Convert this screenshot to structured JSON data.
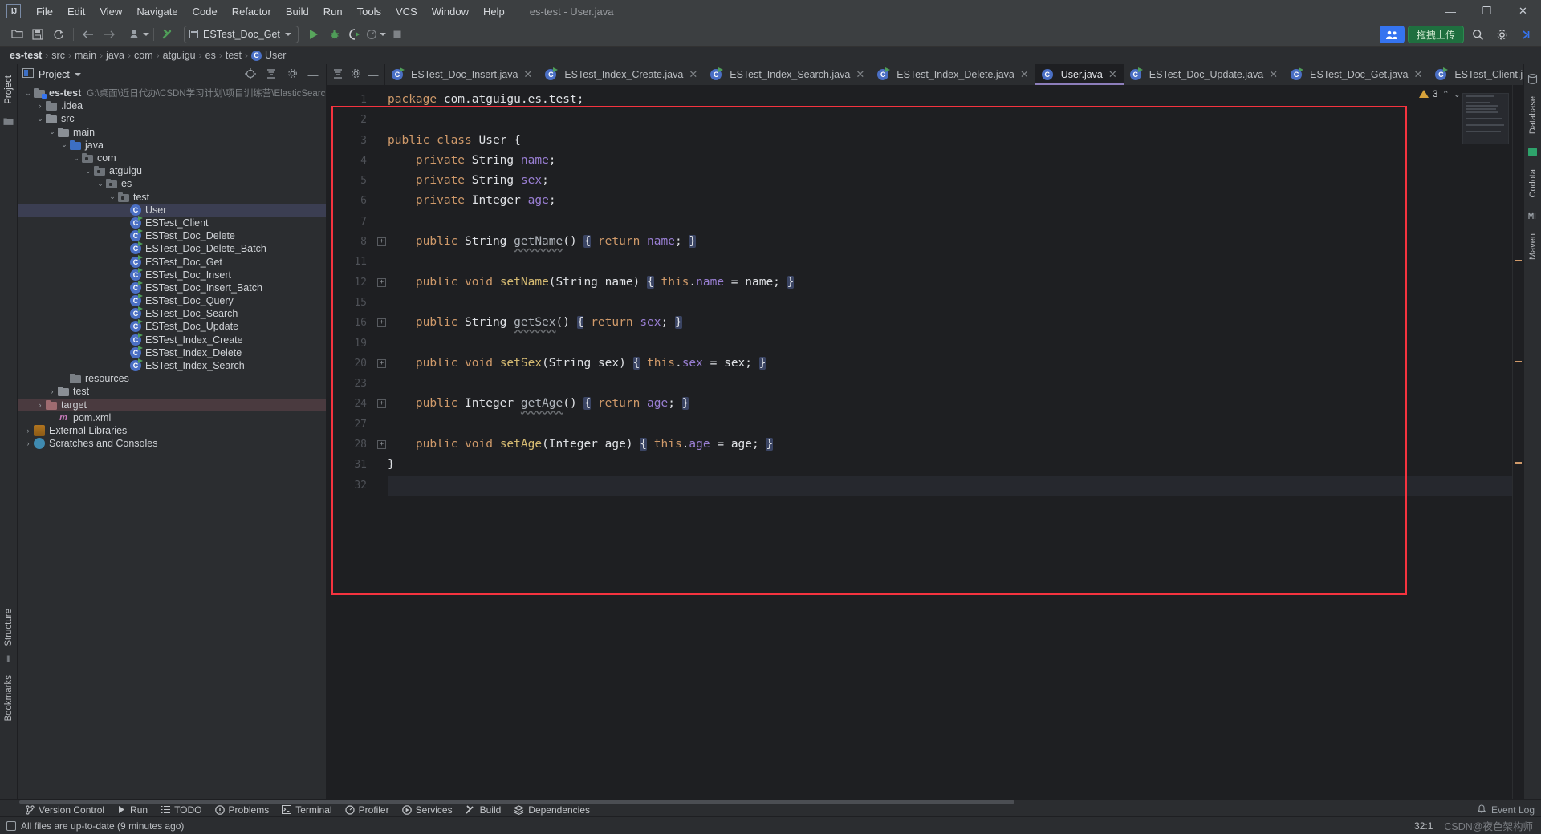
{
  "window": {
    "title": "es-test - User.java",
    "logo": "IJ",
    "minimize": "—",
    "maximize": "❐",
    "close": "✕"
  },
  "menu": {
    "items": [
      "File",
      "Edit",
      "View",
      "Navigate",
      "Code",
      "Refactor",
      "Build",
      "Run",
      "Tools",
      "VCS",
      "Window",
      "Help"
    ]
  },
  "toolbar": {
    "icons": [
      "open-folder-icon",
      "save-icon",
      "sync-icon",
      "back-arrow-icon",
      "forward-arrow-icon",
      "profile-icon",
      "build-hammer-icon"
    ],
    "run_config": "ESTest_Doc_Get",
    "run_label": "run-icon",
    "debug_label": "debug-icon",
    "coverage_label": "run-coverage-icon",
    "profile_label": "profiler-icon",
    "stop_label": "stop-icon",
    "right_badge_blue": "👥",
    "right_badge_green": "拖拽上传",
    "search_icon": "search-icon",
    "settings_icon": "gear-icon",
    "expand_icon": "chevron-right-icon"
  },
  "breadcrumb": {
    "items": [
      "es-test",
      "src",
      "main",
      "java",
      "com",
      "atguigu",
      "es"
    ],
    "last_folder": "test",
    "class": "User",
    "separator": "›"
  },
  "left_strip": {
    "project_label": "Project",
    "structure_label": "Structure",
    "bookmarks_label": "Bookmarks",
    "folder_icon": "folder-icon"
  },
  "right_strip": {
    "database_label": "Database",
    "codota_label": "Codota",
    "maven_label": "Maven"
  },
  "project_panel": {
    "title": "Project",
    "dropdown_icon": "chevron-down-icon",
    "locate_icon": "target-icon",
    "collapse_icon": "collapse-all-icon",
    "settings_icon": "gear-icon",
    "hide_icon": "minimize-icon",
    "tree": [
      {
        "label": "es-test",
        "path": "G:\\桌面\\近日代办\\CSDN学习计划\\项目训练营\\ElasticSearch\\代码\\es-te",
        "indent": 0,
        "arrow": "⌄",
        "icon": "module-folder",
        "bold": true
      },
      {
        "label": ".idea",
        "indent": 1,
        "arrow": "›",
        "icon": "folder"
      },
      {
        "label": "src",
        "indent": 1,
        "arrow": "⌄",
        "icon": "folder-src"
      },
      {
        "label": "main",
        "indent": 2,
        "arrow": "⌄",
        "icon": "folder-src"
      },
      {
        "label": "java",
        "indent": 3,
        "arrow": "⌄",
        "icon": "folder-blue"
      },
      {
        "label": "com",
        "indent": 4,
        "arrow": "⌄",
        "icon": "folder-pkg"
      },
      {
        "label": "atguigu",
        "indent": 5,
        "arrow": "⌄",
        "icon": "folder-pkg"
      },
      {
        "label": "es",
        "indent": 6,
        "arrow": "⌄",
        "icon": "folder-pkg"
      },
      {
        "label": "test",
        "indent": 7,
        "arrow": "⌄",
        "icon": "folder-pkg"
      },
      {
        "label": "User",
        "indent": 8,
        "arrow": "",
        "icon": "java-class",
        "selected": true
      },
      {
        "label": "ESTest_Client",
        "indent": 8,
        "arrow": "",
        "icon": "java-class-runnable"
      },
      {
        "label": "ESTest_Doc_Delete",
        "indent": 8,
        "arrow": "",
        "icon": "java-class-runnable"
      },
      {
        "label": "ESTest_Doc_Delete_Batch",
        "indent": 8,
        "arrow": "",
        "icon": "java-class-runnable"
      },
      {
        "label": "ESTest_Doc_Get",
        "indent": 8,
        "arrow": "",
        "icon": "java-class-runnable"
      },
      {
        "label": "ESTest_Doc_Insert",
        "indent": 8,
        "arrow": "",
        "icon": "java-class-runnable"
      },
      {
        "label": "ESTest_Doc_Insert_Batch",
        "indent": 8,
        "arrow": "",
        "icon": "java-class-runnable"
      },
      {
        "label": "ESTest_Doc_Query",
        "indent": 8,
        "arrow": "",
        "icon": "java-class-runnable"
      },
      {
        "label": "ESTest_Doc_Search",
        "indent": 8,
        "arrow": "",
        "icon": "java-class-runnable"
      },
      {
        "label": "ESTest_Doc_Update",
        "indent": 8,
        "arrow": "",
        "icon": "java-class-runnable"
      },
      {
        "label": "ESTest_Index_Create",
        "indent": 8,
        "arrow": "",
        "icon": "java-class-runnable"
      },
      {
        "label": "ESTest_Index_Delete",
        "indent": 8,
        "arrow": "",
        "icon": "java-class-runnable"
      },
      {
        "label": "ESTest_Index_Search",
        "indent": 8,
        "arrow": "",
        "icon": "java-class-runnable"
      },
      {
        "label": "resources",
        "indent": 3,
        "arrow": "",
        "icon": "folder"
      },
      {
        "label": "test",
        "indent": 2,
        "arrow": "›",
        "icon": "folder-src"
      },
      {
        "label": "target",
        "indent": 1,
        "arrow": "›",
        "icon": "folder-red",
        "highlight": true
      },
      {
        "label": "pom.xml",
        "indent": 2,
        "arrow": "",
        "icon": "maven-xml"
      },
      {
        "label": "External Libraries",
        "indent": 0,
        "arrow": "›",
        "icon": "library"
      },
      {
        "label": "Scratches and Consoles",
        "indent": 0,
        "arrow": "›",
        "icon": "scratch"
      }
    ]
  },
  "editor_tabs": {
    "pre_icons": [
      "collapse-all-icon",
      "gear-icon",
      "minimize-icon"
    ],
    "tabs": [
      {
        "label": "ESTest_Doc_Insert.java",
        "icon": "java-class-runnable",
        "active": false
      },
      {
        "label": "ESTest_Index_Create.java",
        "icon": "java-class-runnable",
        "active": false
      },
      {
        "label": "ESTest_Index_Search.java",
        "icon": "java-class-runnable",
        "active": false
      },
      {
        "label": "ESTest_Index_Delete.java",
        "icon": "java-class-runnable",
        "active": false
      },
      {
        "label": "User.java",
        "icon": "java-class",
        "active": true
      },
      {
        "label": "ESTest_Doc_Update.java",
        "icon": "java-class-runnable",
        "active": false
      },
      {
        "label": "ESTest_Doc_Get.java",
        "icon": "java-class-runnable",
        "active": false
      },
      {
        "label": "ESTest_Client.ja",
        "icon": "java-class-runnable",
        "active": false
      }
    ],
    "overflow_icon": "chevron-down-icon",
    "more_icon": "more-vertical-icon",
    "close_icon": "✕"
  },
  "inspection": {
    "warning_count": "3",
    "warning_icon": "warning-triangle-icon",
    "up_icon": "chevron-up-icon",
    "down_icon": "chevron-down-icon"
  },
  "code": {
    "file": "User.java",
    "lines": [
      {
        "num": "1",
        "fold": false,
        "tokens": [
          {
            "t": "k",
            "v": "package "
          },
          {
            "t": "t",
            "v": "com.atguigu.es.test;"
          }
        ]
      },
      {
        "num": "2",
        "fold": false,
        "tokens": []
      },
      {
        "num": "3",
        "fold": false,
        "tokens": [
          {
            "t": "k",
            "v": "public class "
          },
          {
            "t": "t",
            "v": "User {"
          }
        ]
      },
      {
        "num": "4",
        "fold": false,
        "tokens": [
          {
            "t": "t",
            "v": "    "
          },
          {
            "t": "k",
            "v": "private "
          },
          {
            "t": "t",
            "v": "String "
          },
          {
            "t": "f",
            "v": "name"
          },
          {
            "t": "t",
            "v": ";"
          }
        ]
      },
      {
        "num": "5",
        "fold": false,
        "tokens": [
          {
            "t": "t",
            "v": "    "
          },
          {
            "t": "k",
            "v": "private "
          },
          {
            "t": "t",
            "v": "String "
          },
          {
            "t": "f",
            "v": "sex"
          },
          {
            "t": "t",
            "v": ";"
          }
        ]
      },
      {
        "num": "6",
        "fold": false,
        "tokens": [
          {
            "t": "t",
            "v": "    "
          },
          {
            "t": "k",
            "v": "private "
          },
          {
            "t": "t",
            "v": "Integer "
          },
          {
            "t": "f",
            "v": "age"
          },
          {
            "t": "t",
            "v": ";"
          }
        ]
      },
      {
        "num": "7",
        "fold": false,
        "tokens": []
      },
      {
        "num": "8",
        "fold": true,
        "tokens": [
          {
            "t": "t",
            "v": "    "
          },
          {
            "t": "k",
            "v": "public "
          },
          {
            "t": "t",
            "v": "String "
          },
          {
            "t": "mu",
            "v": "getName"
          },
          {
            "t": "t",
            "v": "() "
          },
          {
            "t": "brace",
            "v": "{"
          },
          {
            "t": "t",
            "v": " "
          },
          {
            "t": "k",
            "v": "return "
          },
          {
            "t": "f",
            "v": "name"
          },
          {
            "t": "t",
            "v": "; "
          },
          {
            "t": "brace",
            "v": "}"
          }
        ]
      },
      {
        "num": "11",
        "fold": false,
        "tokens": []
      },
      {
        "num": "12",
        "fold": true,
        "tokens": [
          {
            "t": "t",
            "v": "    "
          },
          {
            "t": "k",
            "v": "public "
          },
          {
            "t": "k",
            "v": "void "
          },
          {
            "t": "m",
            "v": "setName"
          },
          {
            "t": "t",
            "v": "(String name) "
          },
          {
            "t": "brace",
            "v": "{"
          },
          {
            "t": "t",
            "v": " "
          },
          {
            "t": "k",
            "v": "this"
          },
          {
            "t": "t",
            "v": "."
          },
          {
            "t": "f",
            "v": "name"
          },
          {
            "t": "t",
            "v": " = name; "
          },
          {
            "t": "brace",
            "v": "}"
          }
        ]
      },
      {
        "num": "15",
        "fold": false,
        "tokens": []
      },
      {
        "num": "16",
        "fold": true,
        "tokens": [
          {
            "t": "t",
            "v": "    "
          },
          {
            "t": "k",
            "v": "public "
          },
          {
            "t": "t",
            "v": "String "
          },
          {
            "t": "mu",
            "v": "getSex"
          },
          {
            "t": "t",
            "v": "() "
          },
          {
            "t": "brace",
            "v": "{"
          },
          {
            "t": "t",
            "v": " "
          },
          {
            "t": "k",
            "v": "return "
          },
          {
            "t": "f",
            "v": "sex"
          },
          {
            "t": "t",
            "v": "; "
          },
          {
            "t": "brace",
            "v": "}"
          }
        ]
      },
      {
        "num": "19",
        "fold": false,
        "tokens": []
      },
      {
        "num": "20",
        "fold": true,
        "tokens": [
          {
            "t": "t",
            "v": "    "
          },
          {
            "t": "k",
            "v": "public "
          },
          {
            "t": "k",
            "v": "void "
          },
          {
            "t": "m",
            "v": "setSex"
          },
          {
            "t": "t",
            "v": "(String sex) "
          },
          {
            "t": "brace",
            "v": "{"
          },
          {
            "t": "t",
            "v": " "
          },
          {
            "t": "k",
            "v": "this"
          },
          {
            "t": "t",
            "v": "."
          },
          {
            "t": "f",
            "v": "sex"
          },
          {
            "t": "t",
            "v": " = sex; "
          },
          {
            "t": "brace",
            "v": "}"
          }
        ]
      },
      {
        "num": "23",
        "fold": false,
        "tokens": []
      },
      {
        "num": "24",
        "fold": true,
        "tokens": [
          {
            "t": "t",
            "v": "    "
          },
          {
            "t": "k",
            "v": "public "
          },
          {
            "t": "t",
            "v": "Integer "
          },
          {
            "t": "mu",
            "v": "getAge"
          },
          {
            "t": "t",
            "v": "() "
          },
          {
            "t": "brace",
            "v": "{"
          },
          {
            "t": "t",
            "v": " "
          },
          {
            "t": "k",
            "v": "return "
          },
          {
            "t": "f",
            "v": "age"
          },
          {
            "t": "t",
            "v": "; "
          },
          {
            "t": "brace",
            "v": "}"
          }
        ]
      },
      {
        "num": "27",
        "fold": false,
        "tokens": []
      },
      {
        "num": "28",
        "fold": true,
        "tokens": [
          {
            "t": "t",
            "v": "    "
          },
          {
            "t": "k",
            "v": "public "
          },
          {
            "t": "k",
            "v": "void "
          },
          {
            "t": "m",
            "v": "setAge"
          },
          {
            "t": "t",
            "v": "(Integer age) "
          },
          {
            "t": "brace",
            "v": "{"
          },
          {
            "t": "t",
            "v": " "
          },
          {
            "t": "k",
            "v": "this"
          },
          {
            "t": "t",
            "v": "."
          },
          {
            "t": "f",
            "v": "age"
          },
          {
            "t": "t",
            "v": " = age; "
          },
          {
            "t": "brace",
            "v": "}"
          }
        ]
      },
      {
        "num": "31",
        "fold": false,
        "tokens": [
          {
            "t": "t",
            "v": "}"
          }
        ]
      },
      {
        "num": "32",
        "fold": false,
        "tokens": [],
        "highlight": true
      }
    ]
  },
  "bottom_bar": {
    "items": [
      {
        "label": "Version Control",
        "icon": "branch-icon"
      },
      {
        "label": "Run",
        "icon": "run-icon"
      },
      {
        "label": "TODO",
        "icon": "list-icon"
      },
      {
        "label": "Problems",
        "icon": "error-icon"
      },
      {
        "label": "Terminal",
        "icon": "terminal-icon"
      },
      {
        "label": "Profiler",
        "icon": "profiler-icon"
      },
      {
        "label": "Services",
        "icon": "services-icon"
      },
      {
        "label": "Build",
        "icon": "hammer-icon"
      },
      {
        "label": "Dependencies",
        "icon": "layers-icon"
      }
    ],
    "event_log": "Event Log",
    "event_log_icon": "bell-icon"
  },
  "status_bar": {
    "message": "All files are up-to-date (9 minutes ago)",
    "message_icon": "document-icon",
    "caret_position": "32:1",
    "watermark": "CSDN@夜色架构师"
  }
}
